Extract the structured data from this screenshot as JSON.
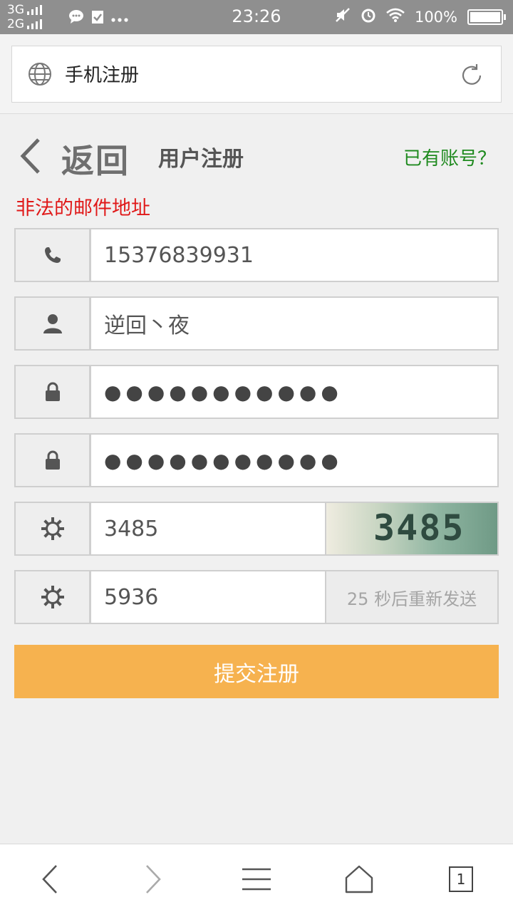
{
  "status_bar": {
    "network_top": "3G",
    "network_bottom": "2G",
    "time": "23:26",
    "battery": "100%"
  },
  "browser": {
    "url_title": "手机注册",
    "tab_count": "1"
  },
  "header": {
    "back_text": "返回",
    "title": "用户注册",
    "has_account_link": "已有账号？"
  },
  "form": {
    "error_message": "非法的邮件地址",
    "phone": "15376839931",
    "username": "逆回丶夜",
    "password_mask": "●●●●●●●●●●●",
    "password_confirm_mask": "●●●●●●●●●●●",
    "captcha_input": "3485",
    "captcha_image_text": "3485",
    "sms_code": "5936",
    "resend_label": "25 秒后重新发送",
    "submit_label": "提交注册"
  },
  "colors": {
    "error": "#e01919",
    "link": "#1f8a1f",
    "submit": "#f6b24f"
  }
}
